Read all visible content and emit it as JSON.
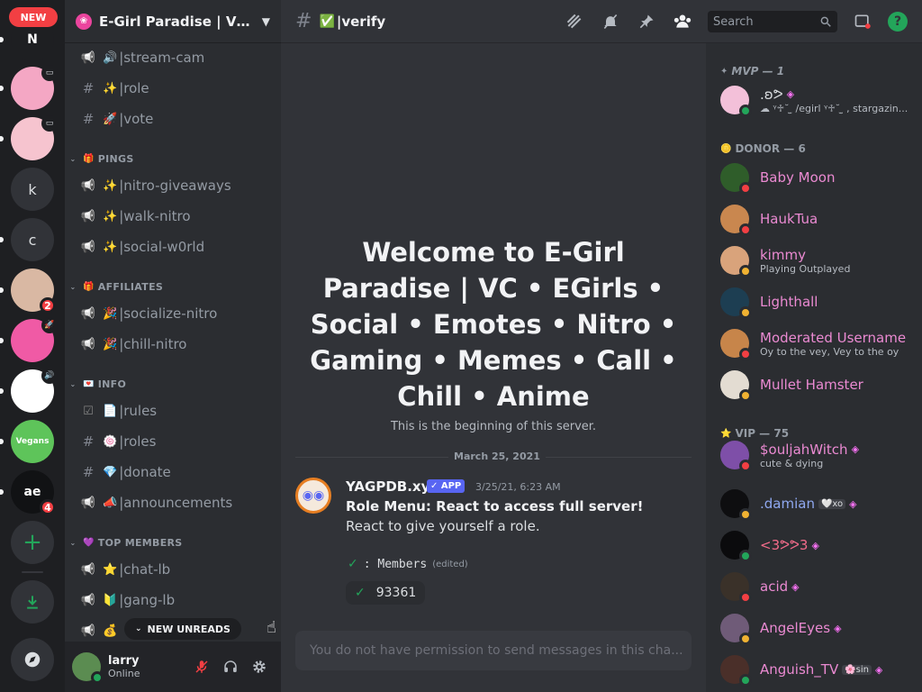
{
  "rail": {
    "new_label": "NEW",
    "servers": [
      {
        "kind": "logo",
        "initial": "",
        "color": "#1e1f22",
        "glyph": "N"
      },
      {
        "kind": "server",
        "initial": "",
        "color": "#f4a7c4",
        "glyph": "",
        "mini": "monitor-icon"
      },
      {
        "kind": "server",
        "initial": "",
        "color": "#f6c4cf",
        "glyph": "",
        "mini": "monitor-icon"
      },
      {
        "kind": "server",
        "initial": "k",
        "color": "#313338",
        "glyph": ""
      },
      {
        "kind": "server",
        "initial": "c",
        "color": "#313338",
        "glyph": ""
      },
      {
        "kind": "server",
        "initial": "",
        "color": "#d9b8a3",
        "glyph": "",
        "badge": "2"
      },
      {
        "kind": "server",
        "initial": "",
        "color": "#f05aa5",
        "glyph": "",
        "mini": "rocket-icon"
      },
      {
        "kind": "server",
        "initial": "",
        "color": "#ffffff",
        "glyph": "",
        "mini": "speaker-icon"
      },
      {
        "kind": "server",
        "initial": "",
        "color": "#5ec45a",
        "glyph": "Vegans"
      },
      {
        "kind": "server",
        "initial": "",
        "color": "#111214",
        "glyph": "ae",
        "badge": "4"
      }
    ]
  },
  "server": {
    "name": "E-Girl Paradise | VC • ...",
    "chevron": "chevron-down-icon"
  },
  "channels": [
    {
      "type": "voice",
      "emoji": "🔊",
      "name": "|stream-cam"
    },
    {
      "type": "text",
      "emoji": "✨",
      "name": "|role"
    },
    {
      "type": "text",
      "emoji": "🚀",
      "name": "|vote"
    },
    {
      "type": "category",
      "emoji": "🎁",
      "name": "PINGS"
    },
    {
      "type": "announce",
      "emoji": "✨",
      "name": "|nitro-giveaways"
    },
    {
      "type": "announce",
      "emoji": "✨",
      "name": "|walk-nitro"
    },
    {
      "type": "announce",
      "emoji": "✨",
      "name": "|social-w0rld"
    },
    {
      "type": "category",
      "emoji": "🎁",
      "name": "AFFILIATES"
    },
    {
      "type": "announce",
      "emoji": "🎉",
      "name": "|socialize-nitro"
    },
    {
      "type": "announce",
      "emoji": "🎉",
      "name": "|chill-nitro"
    },
    {
      "type": "category",
      "emoji": "💌",
      "name": "INFO"
    },
    {
      "type": "rules",
      "emoji": "📄",
      "name": "|rules"
    },
    {
      "type": "text",
      "emoji": "🍥",
      "name": "|roles"
    },
    {
      "type": "text",
      "emoji": "💎",
      "name": "|donate"
    },
    {
      "type": "announce",
      "emoji": "📣",
      "name": "|announcements"
    },
    {
      "type": "category",
      "emoji": "💜",
      "name": "TOP MEMBERS"
    },
    {
      "type": "announce",
      "emoji": "⭐",
      "name": "|chat-lb"
    },
    {
      "type": "announce",
      "emoji": "🔰",
      "name": "|gang-lb"
    },
    {
      "type": "announce",
      "emoji": "💰",
      "name": ""
    }
  ],
  "new_unreads": "NEW UNREADS",
  "user": {
    "name": "larry",
    "status": "Online"
  },
  "chat": {
    "channel_emoji": "✅",
    "channel_name": "|verify",
    "search_placeholder": "Search",
    "welcome": "Welcome to E-Girl Paradise | VC • EGirls • Social • Emotes • Nitro • Gaming • Memes • Call • Chill • Anime",
    "welcome_sub": "This is the beginning of this server.",
    "date_divider": "March 25, 2021",
    "message": {
      "author": "YAGPDB.xyz",
      "badge": "✓ APP",
      "timestamp": "3/25/21, 6:23 AM",
      "line1": "Role Menu: React to access full server!",
      "line2": "React to give yourself a role.",
      "role_check": "✓",
      "role_label": ": Members",
      "edited": "(edited)",
      "reaction_count": "93361"
    },
    "composer_placeholder": "You do not have permission to send messages in this cha..."
  },
  "members": {
    "groups": [
      {
        "label": "MVP — 1",
        "icon": "sparkle-icon",
        "mvp": true
      },
      {
        "label": "DONOR — 6",
        "icon": "coin-icon"
      },
      {
        "label": "VIP — 75",
        "icon": "star-icon"
      }
    ],
    "list": [
      {
        "name": ".ʚᕗ",
        "sub": "☁ ᵞ♱˘ ̫ /egirl ᵞ♱˘ ̫ , stargazin...",
        "color": "#dbdee1",
        "status": "online",
        "avatar": "#f3c0d9",
        "boost": true
      },
      {
        "name": "Baby Moon",
        "sub": "",
        "color": "#eb8ad2",
        "status": "dnd",
        "avatar": "#2f5d2a"
      },
      {
        "name": "HaukTua",
        "sub": "",
        "color": "#eb8ad2",
        "status": "dnd",
        "avatar": "#c9874f"
      },
      {
        "name": "kimmy",
        "sub": "Playing Outplayed",
        "color": "#eb8ad2",
        "status": "idle",
        "avatar": "#d9a37b"
      },
      {
        "name": "Lighthall",
        "sub": "",
        "color": "#eb8ad2",
        "status": "idle",
        "avatar": "#1d3e52"
      },
      {
        "name": "Moderated Username",
        "sub": "Oy to the vey, Vey to the oy",
        "color": "#eb8ad2",
        "status": "dnd",
        "avatar": "#c7854a"
      },
      {
        "name": "Mullet Hamster",
        "sub": "",
        "color": "#eb8ad2",
        "status": "idle",
        "avatar": "#e3dcd2"
      },
      {
        "name": "$ouljahWitch",
        "sub": "cute & dying",
        "color": "#eb8ad2",
        "status": "dnd",
        "avatar": "#7e4fa8",
        "boost": true
      },
      {
        "name": ".damian",
        "sub": "",
        "color": "#8fa8f0",
        "status": "idle",
        "avatar": "#0e0e10",
        "tag": "🤍xo",
        "boost": true
      },
      {
        "name": "<3ᕗᕗ3",
        "sub": "",
        "color": "#f26b8a",
        "status": "online",
        "avatar": "#0b0b0d",
        "boost": true
      },
      {
        "name": "acid",
        "sub": "",
        "color": "#eb8ad2",
        "status": "dnd",
        "avatar": "#3a3129",
        "boost": true
      },
      {
        "name": "AngelEyes",
        "sub": "",
        "color": "#eb8ad2",
        "status": "idle",
        "avatar": "#6f5b78",
        "boost": true
      },
      {
        "name": "Anguish_TV",
        "sub": "",
        "color": "#eb8ad2",
        "status": "online",
        "avatar": "#4a2f29",
        "tag": "🌸sin",
        "boost": true
      }
    ]
  }
}
